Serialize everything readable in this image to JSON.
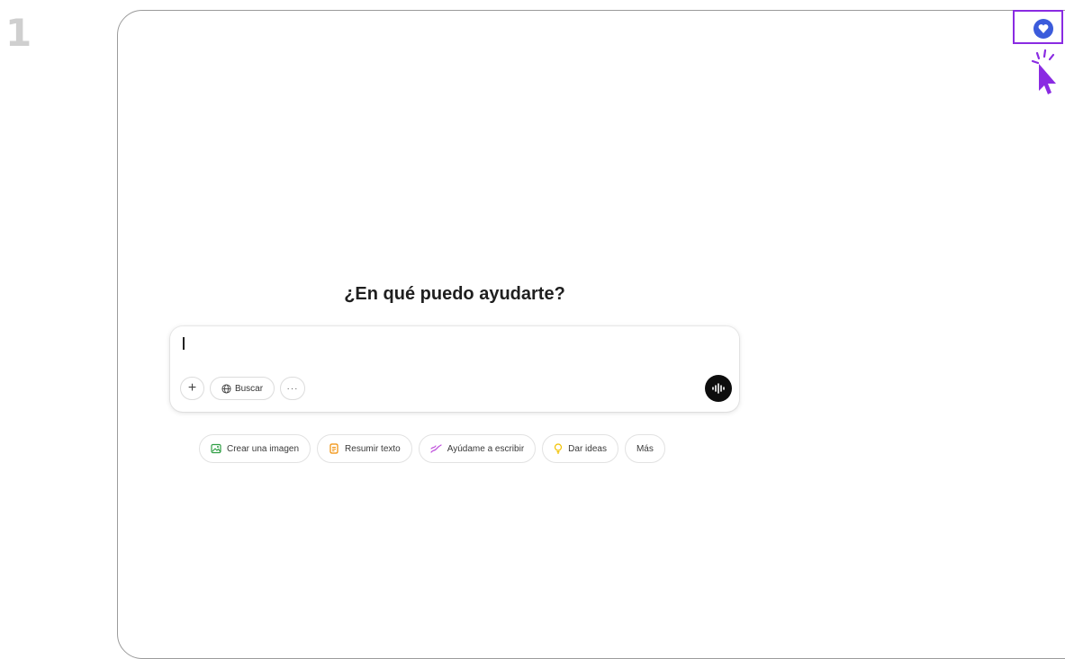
{
  "step": {
    "number": "1"
  },
  "main": {
    "heading": "¿En qué puedo ayudarte?"
  },
  "composer": {
    "search_label": "Buscar",
    "plus_symbol": "+",
    "more_symbol": "···"
  },
  "suggestions": [
    {
      "label": "Crear una imagen",
      "icon": "image-icon",
      "color": "#2f9e44"
    },
    {
      "label": "Resumir texto",
      "icon": "document-icon",
      "color": "#f08c00"
    },
    {
      "label": "Ayúdame a escribir",
      "icon": "pen-icon",
      "color": "#be4bdb"
    },
    {
      "label": "Dar ideas",
      "icon": "lightbulb-icon",
      "color": "#f2c200"
    },
    {
      "label": "Más"
    }
  ],
  "colors": {
    "highlight": "#8a2be2",
    "extension_icon": "#3b5bdb",
    "voice_button": "#0d0d0d"
  }
}
